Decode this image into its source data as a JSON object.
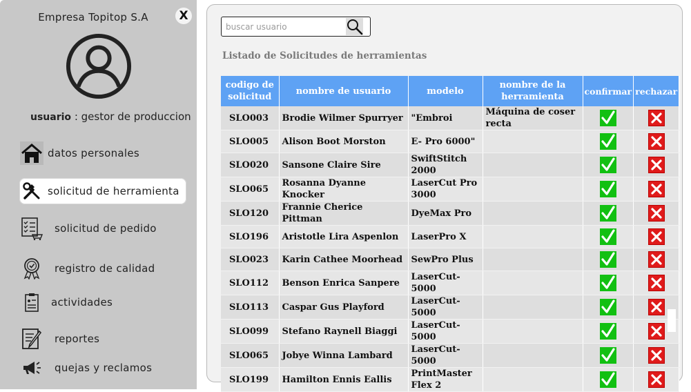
{
  "sidebar": {
    "company": "Empresa Topitop S.A",
    "close_label": "X",
    "user_label": "usuario",
    "user_role": " : gestor de produccion",
    "items": [
      {
        "label": "datos personales",
        "icon": "home-icon"
      },
      {
        "label": "solicitud de herramienta",
        "icon": "tools-icon",
        "active": true
      },
      {
        "label": "solicitud de pedido",
        "icon": "order-list-cart-icon"
      },
      {
        "label": "registro de calidad",
        "icon": "quality-badge-icon"
      },
      {
        "label": "actividades",
        "icon": "activities-clipboard-icon"
      },
      {
        "label": "reportes",
        "icon": "report-edit-icon"
      },
      {
        "label": "quejas y reclamos",
        "icon": "megaphone-icon"
      }
    ]
  },
  "search": {
    "placeholder": "buscar usuario"
  },
  "list_title": "Listado de Solicitudes de herramientas",
  "table": {
    "headers": {
      "code": "codigo de solicitud",
      "name": "nombre de usuario",
      "model": "modelo",
      "tool": "nombre de la herramienta",
      "confirm": "confirmar",
      "reject": "rechazar"
    },
    "rows": [
      {
        "code": "SLO003",
        "name": "Brodie Wilmer Spurryer",
        "model": "\"Embroi",
        "tool": "Máquina de coser recta"
      },
      {
        "code": "SLO005",
        "name": "Alison Boot Morston",
        "model": "E- Pro 6000\"",
        "tool": ""
      },
      {
        "code": "SLO020",
        "name": "Sansone Claire Sire",
        "model": "SwiftStitch 2000",
        "tool": ""
      },
      {
        "code": "SLO065",
        "name": "Rosanna Dyanne Knocker",
        "model": "LaserCut Pro 3000",
        "tool": ""
      },
      {
        "code": "SLO120",
        "name": "Frannie Cherice Pittman",
        "model": "DyeMax Pro",
        "tool": ""
      },
      {
        "code": "SLO196",
        "name": "Aristotle Lira Aspenlon",
        "model": "LaserPro X",
        "tool": ""
      },
      {
        "code": "SLO023",
        "name": "Karin Cathee Moorhead",
        "model": "SewPro Plus",
        "tool": ""
      },
      {
        "code": "SLO112",
        "name": "Benson Enrica Sanpere",
        "model": "LaserCut-5000",
        "tool": ""
      },
      {
        "code": "SLO113",
        "name": "Caspar Gus Playford",
        "model": "LaserCut-5000",
        "tool": ""
      },
      {
        "code": "SLO099",
        "name": "Stefano Raynell Biaggi",
        "model": "LaserCut-5000",
        "tool": ""
      },
      {
        "code": "SLO065",
        "name": "Jobye Winna Lambard",
        "model": "LaserCut-5000",
        "tool": ""
      },
      {
        "code": "SLO199",
        "name": "Hamilton Ennis Eallis",
        "model": "PrintMaster Flex 2",
        "tool": ""
      }
    ]
  },
  "colors": {
    "sidebar_bg": "#c8c8c8",
    "header_bg": "#5ea2f4",
    "confirm_green": "#12c012",
    "reject_red": "#e01b1b"
  }
}
